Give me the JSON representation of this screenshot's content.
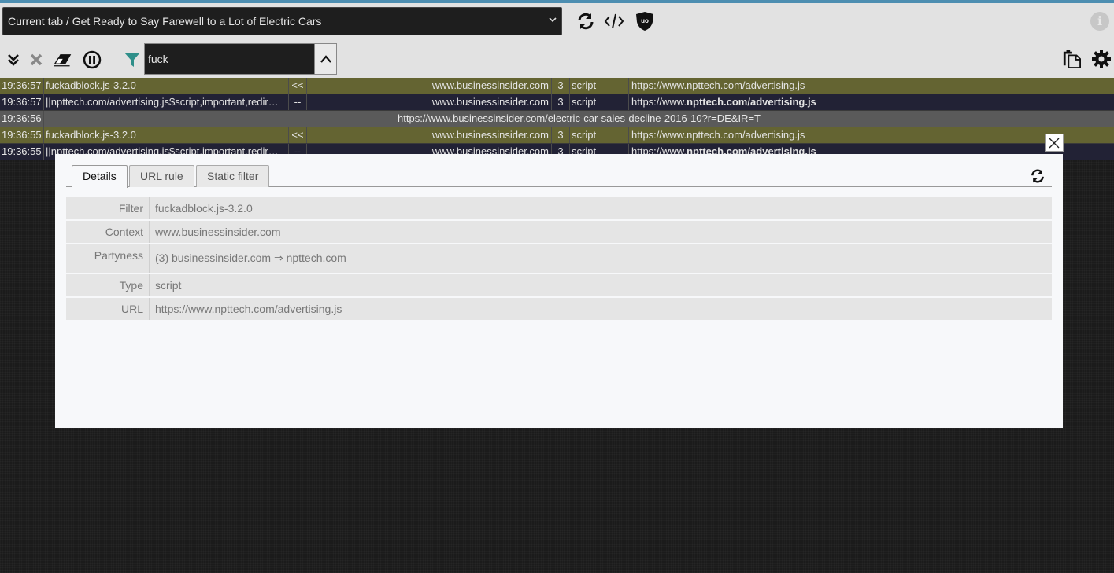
{
  "toolbar": {
    "tab_selector_value": "Current tab / Get Ready to Say Farewell to a Lot of Electric Cars",
    "filter_value": "fuck"
  },
  "log_rows": [
    {
      "time": "19:36:57",
      "filter": "fuckadblock.js-3.2.0",
      "dir": "<<",
      "context": "www.businessinsider.com",
      "party": "3",
      "type": "script",
      "url_prefix": "https://www.npttech.com/advertising.js",
      "url_bold": "",
      "kind": "allowed"
    },
    {
      "time": "19:36:57",
      "filter": "||npttech.com/advertising.js$script,important,redir…",
      "dir": "--",
      "context": "www.businessinsider.com",
      "party": "3",
      "type": "script",
      "url_prefix": "https://www.",
      "url_bold": "npttech.com/advertising.js",
      "kind": "blocked"
    },
    {
      "time": "19:36:56",
      "doc_url": "https://www.businessinsider.com/electric-car-sales-decline-2016-10?r=DE&IR=T",
      "kind": "doc"
    },
    {
      "time": "19:36:55",
      "filter": "fuckadblock.js-3.2.0",
      "dir": "<<",
      "context": "www.businessinsider.com",
      "party": "3",
      "type": "script",
      "url_prefix": "https://www.npttech.com/advertising.js",
      "url_bold": "",
      "kind": "allowed"
    },
    {
      "time": "19:36:55",
      "filter": "||npttech.com/advertising.js$script,important,redir…",
      "dir": "--",
      "context": "www.businessinsider.com",
      "party": "3",
      "type": "script",
      "url_prefix": "https://www.",
      "url_bold": "npttech.com/advertising.js",
      "kind": "blocked"
    }
  ],
  "modal": {
    "tabs": [
      "Details",
      "URL rule",
      "Static filter"
    ],
    "details": [
      {
        "label": "Filter",
        "value": "fuckadblock.js-3.2.0"
      },
      {
        "label": "Context",
        "value": "www.businessinsider.com"
      },
      {
        "label": "Partyness",
        "value": "(3) businessinsider.com ⇒ npttech.com"
      },
      {
        "label": "Type",
        "value": "script"
      },
      {
        "label": "URL",
        "value": "https://www.npttech.com/advertising.js"
      }
    ]
  },
  "colors": {
    "allowed_row": "#646432",
    "blocked_row": "#222235",
    "doc_row": "#5a5a5a",
    "filter_funnel": "#2f8f8a"
  },
  "icons": [
    "refresh-icon",
    "code-icon",
    "ublock-shield-icon",
    "info-icon",
    "expand-down-icon",
    "clear-x-icon",
    "eraser-icon",
    "pause-icon",
    "filter-funnel-icon",
    "chevron-up-icon",
    "clipboard-icon",
    "gear-icon",
    "close-icon"
  ]
}
